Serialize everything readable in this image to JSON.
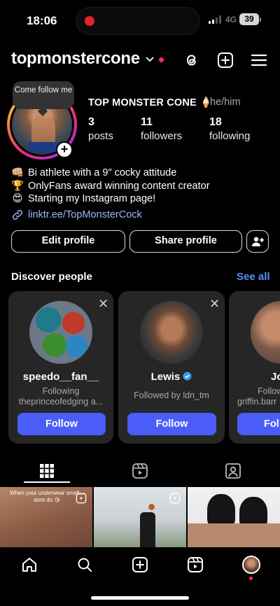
{
  "status": {
    "time": "18:06",
    "network": "4G",
    "battery": "39"
  },
  "header": {
    "username": "topmonstercone"
  },
  "tooltip": {
    "text": "Come follow me"
  },
  "profile": {
    "display_name": "TOP MONSTER CONE 🍦",
    "pronouns": "he/him",
    "stats": [
      {
        "value": "3",
        "label": "posts"
      },
      {
        "value": "11",
        "label": "followers"
      },
      {
        "value": "18",
        "label": "following"
      }
    ],
    "bio": [
      {
        "emoji": "👊🏼",
        "text": "Bi athlete with a 9″ cocky attitude"
      },
      {
        "emoji": "🏆",
        "text": "OnlyFans award winning content creator"
      },
      {
        "emoji": "😍",
        "text": "Starting my Instagram page!"
      }
    ],
    "link": "linktr.ee/TopMonsterCock"
  },
  "buttons": {
    "edit_profile": "Edit profile",
    "share_profile": "Share profile"
  },
  "discover": {
    "title": "Discover people",
    "see_all": "See all",
    "cards": [
      {
        "name": "speedo__fan__",
        "sub1": "Following",
        "sub2": "theprinceofedging a...",
        "follow": "Follow"
      },
      {
        "name": "Lewis",
        "verified": true,
        "sub1": "Followed by ldn_tm",
        "follow": "Follow"
      },
      {
        "name": "Jo",
        "sub1": "Follow",
        "sub2": "griffin.barr",
        "follow": "Fol"
      }
    ]
  },
  "grid": {
    "tile1_caption": "When your underwear smell... dont do 😘"
  },
  "colors": {
    "accent": "#4a5df9",
    "link": "#a0b4ff",
    "see_all": "#5b8cff",
    "card_bg": "#262626"
  }
}
